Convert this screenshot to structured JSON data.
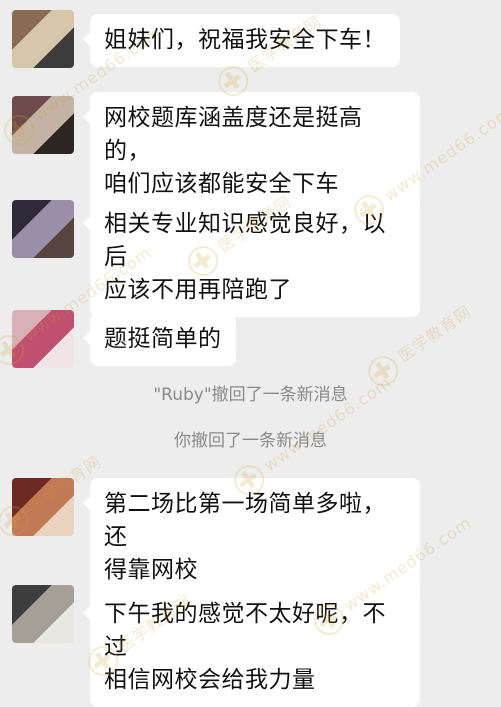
{
  "messages": [
    {
      "text": "姐妹们，祝福我安全下车！",
      "avatar_colors": [
        "#8a6a52",
        "#d7c6ab",
        "#3b3b3b"
      ]
    },
    {
      "text": "网校题库涵盖度还是挺高的，\n咱们应该都能安全下车",
      "avatar_colors": [
        "#6f4a4a",
        "#c2b3a4",
        "#2c2622"
      ]
    },
    {
      "text": "相关专业知识感觉良好，以后\n应该不用再陪跑了",
      "avatar_colors": [
        "#2e2a3a",
        "#9a8fa6",
        "#55463f"
      ]
    },
    {
      "text": "题挺简单的",
      "avatar_colors": [
        "#d8b0b6",
        "#c0506f",
        "#f2e4e6"
      ]
    },
    {
      "text": "第二场比第一场简单多啦，还\n得靠网校",
      "avatar_colors": [
        "#6d2a25",
        "#c07a56",
        "#e9d3bf"
      ]
    },
    {
      "text": "下午我的感觉不太好呢，不过\n相信网校会给我力量",
      "avatar_colors": [
        "#3d3d3d",
        "#a4a095",
        "#e7e6e1"
      ]
    }
  ],
  "system_notices": [
    "\"Ruby\"撤回了一条新消息",
    "你撤回了一条新消息"
  ],
  "watermark": {
    "brand_cn": "医学教育网",
    "brand_url": "www.med66.com",
    "color": "#c89a2a"
  },
  "colors": {
    "background": "#ededed",
    "bubble": "#ffffff",
    "text": "#111111",
    "system_text": "#8a8a8a"
  }
}
